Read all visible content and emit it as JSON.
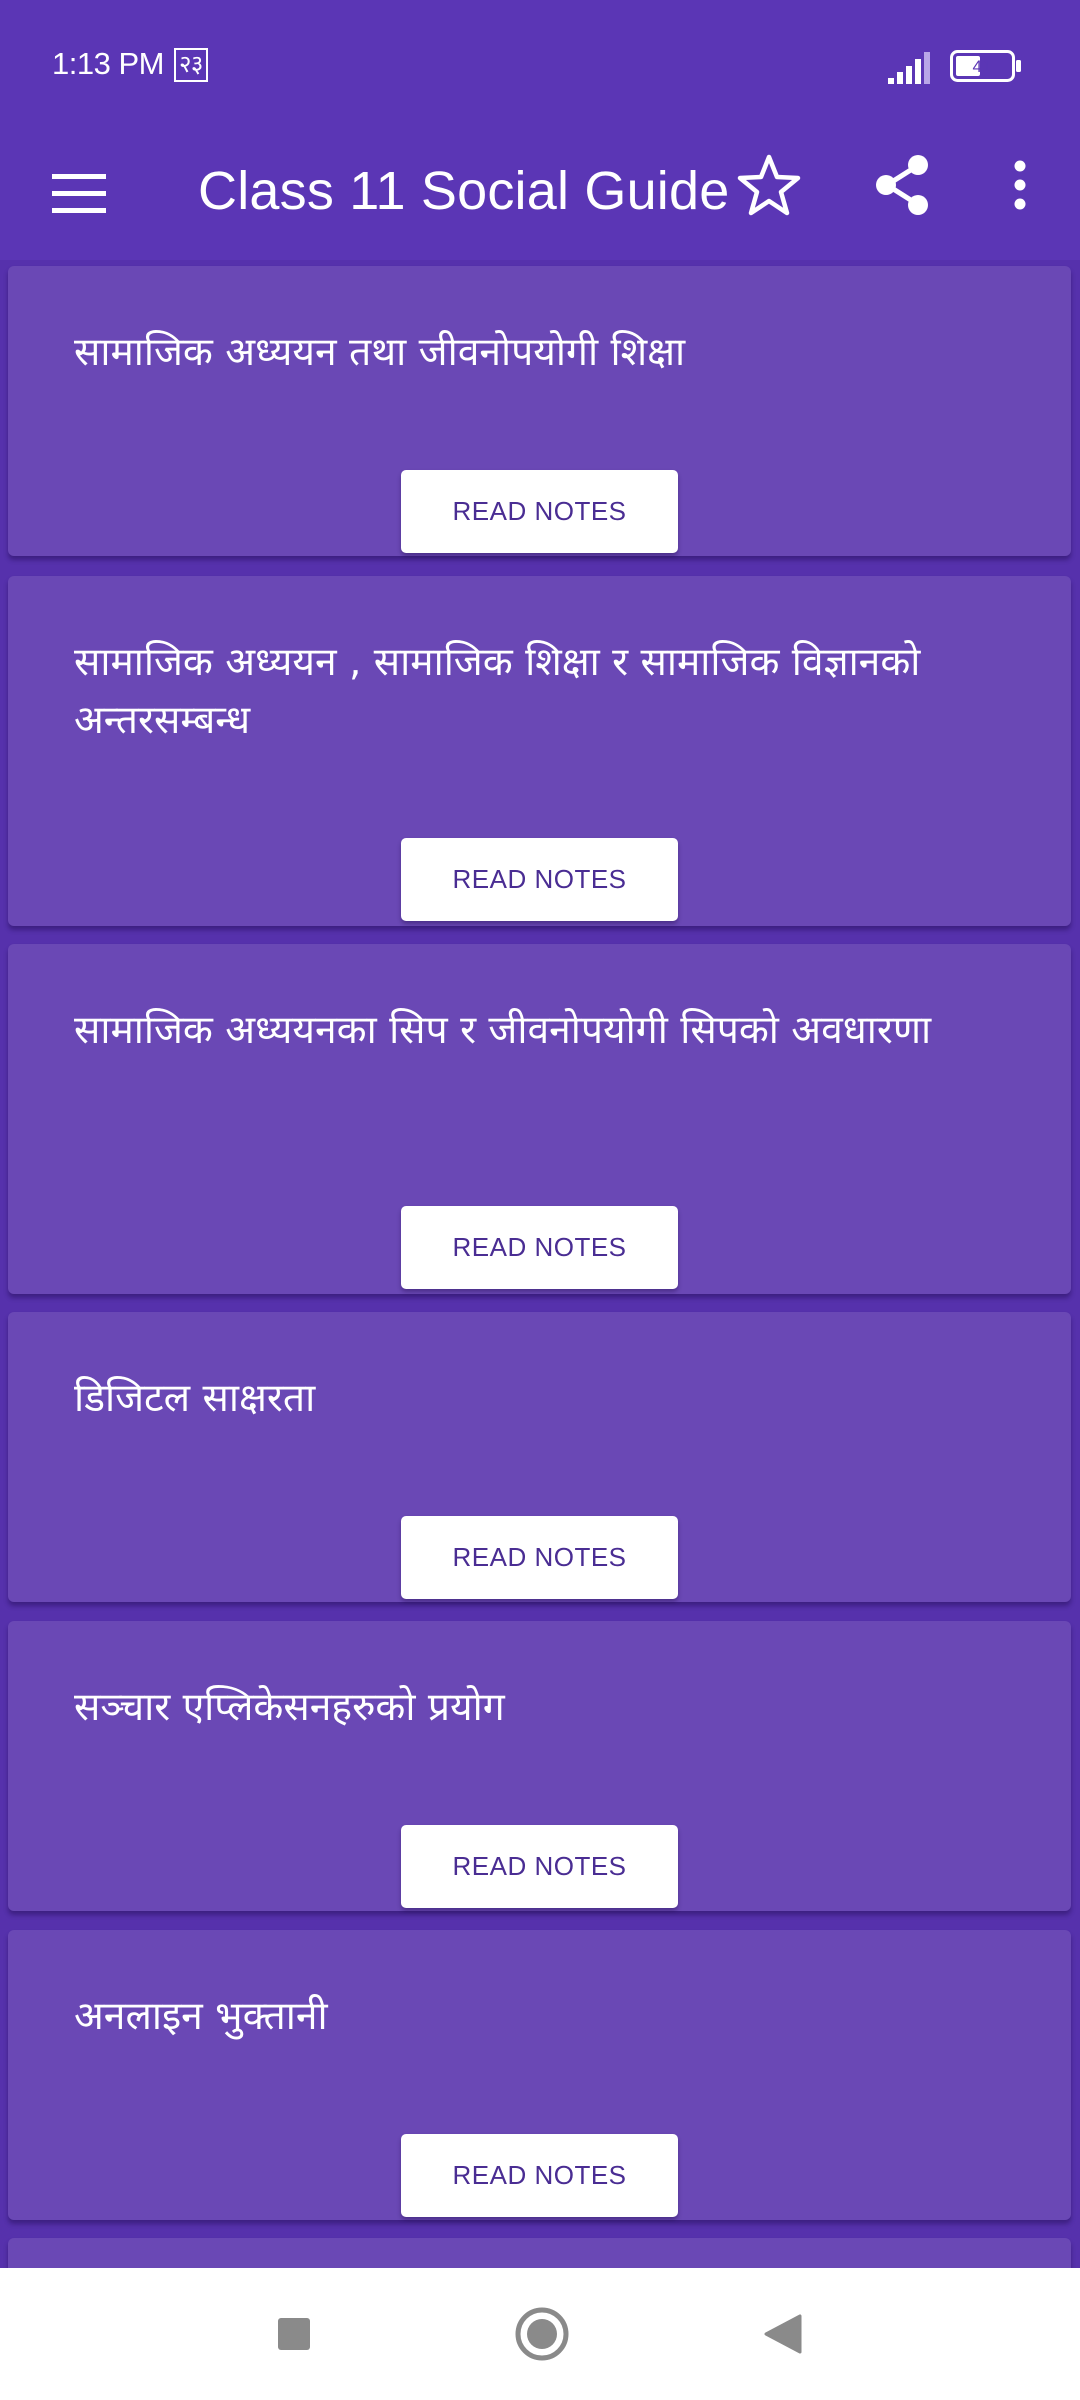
{
  "status_bar": {
    "time": "1:13 PM",
    "extra": "२३",
    "battery": "41"
  },
  "app_bar": {
    "title": "Class 11 Social Guide",
    "icons": [
      "menu-icon",
      "star-icon",
      "share-icon",
      "more-vert-icon"
    ]
  },
  "lessons": [
    {
      "title": "सामाजिक अध्ययन तथा जीवनोपयोगी शिक्षा",
      "button": "READ NOTES"
    },
    {
      "title": "सामाजिक अध्ययन , सामाजिक शिक्षा र सामाजिक विज्ञानको अन्तरसम्बन्ध",
      "button": "READ NOTES"
    },
    {
      "title": "सामाजिक अध्ययनका सिप र जीवनोपयोगी सिपको अवधारणा",
      "button": "READ NOTES"
    },
    {
      "title": "डिजिटल साक्षरता",
      "button": "READ NOTES"
    },
    {
      "title": "सञ्चार एप्लिकेसनहरुको प्रयोग",
      "button": "READ NOTES"
    },
    {
      "title": "अनलाइन भुक्तानी",
      "button": "READ NOTES"
    }
  ],
  "colors": {
    "primary": "#5b36b5",
    "card": "#6a48b5",
    "button_text": "#4a2d93"
  }
}
